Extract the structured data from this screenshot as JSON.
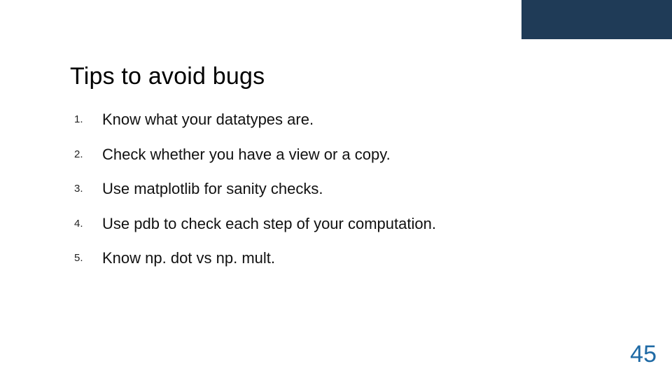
{
  "slide": {
    "title": "Tips to avoid bugs",
    "tips": [
      "Know what your datatypes are.",
      "Check whether you have a view or a copy.",
      "Use matplotlib for sanity checks.",
      "Use pdb to check each step of your computation.",
      "Know np. dot vs np. mult."
    ],
    "page_number": "45"
  },
  "colors": {
    "accent": "#1f3b57",
    "page_number": "#1f6aa5"
  }
}
